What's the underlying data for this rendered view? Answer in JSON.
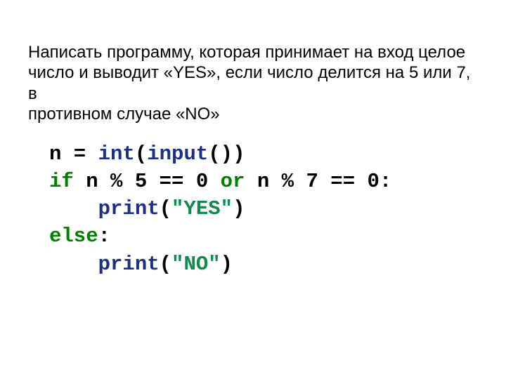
{
  "task": {
    "line1": "Написать программу, которая принимает на вход целое",
    "line2": "число и выводит «YES», если число делится на 5 или 7, в",
    "line3": "противном случае «NO»"
  },
  "code": {
    "l1_a": "n = ",
    "l1_int": "int",
    "l1_p1": "(",
    "l1_input": "input",
    "l1_p2": "())",
    "l2_if": "if",
    "l2_a": " n % 5 == 0 ",
    "l2_or": "or",
    "l2_b": " n % 7 == 0:",
    "l3_ind": "    ",
    "l3_print": "print",
    "l3_p1": "(",
    "l3_str": "\"YES\"",
    "l3_p2": ")",
    "l4_else": "else",
    "l4_colon": ":",
    "l5_ind": "    ",
    "l5_print": "print",
    "l5_p1": "(",
    "l5_str": "\"NO\"",
    "l5_p2": ")"
  }
}
